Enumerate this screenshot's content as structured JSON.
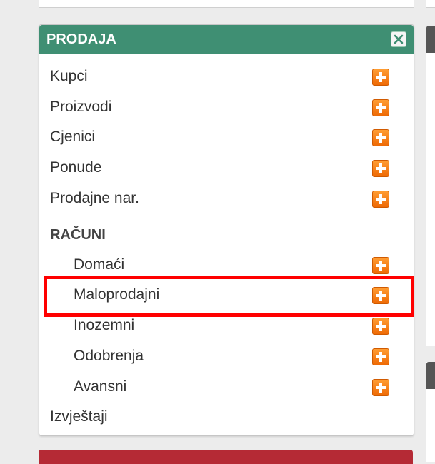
{
  "panel": {
    "title": "PRODAJA",
    "close_icon": "close-icon"
  },
  "menu": {
    "items": [
      {
        "label": "Kupci",
        "add_icon": "plus-icon"
      },
      {
        "label": "Proizvodi",
        "add_icon": "plus-icon"
      },
      {
        "label": "Cjenici",
        "add_icon": "plus-icon"
      },
      {
        "label": "Ponude",
        "add_icon": "plus-icon"
      },
      {
        "label": "Prodajne nar.",
        "add_icon": "plus-icon"
      }
    ],
    "section_title": "RAČUNI",
    "sub_items": [
      {
        "label": "Domaći",
        "add_icon": "plus-icon"
      },
      {
        "label": "Maloprodajni",
        "add_icon": "plus-icon"
      },
      {
        "label": "Inozemni",
        "add_icon": "plus-icon"
      },
      {
        "label": "Odobrenja",
        "add_icon": "plus-icon"
      },
      {
        "label": "Avansni",
        "add_icon": "plus-icon"
      }
    ],
    "footer_item": {
      "label": "Izvještaji"
    }
  },
  "colors": {
    "header": "#3f8f73",
    "add_button": "#f57c11",
    "highlight": "#ff0000"
  }
}
